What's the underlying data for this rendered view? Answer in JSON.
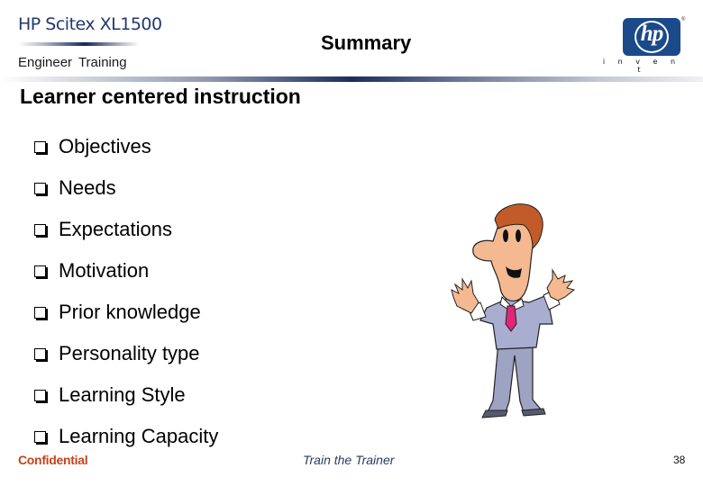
{
  "header": {
    "product_name": "HP Scitex XL1500",
    "subtitle": "Engineer  Training",
    "slide_title": "Summary",
    "logo": {
      "brand": "hp",
      "tagline": "i n v e n t",
      "trademark": "®",
      "color": "#1b4a8a"
    }
  },
  "main": {
    "heading": "Learner centered instruction",
    "bullet_icon": "checkbox-square-icon",
    "bullets": [
      {
        "label": "Objectives"
      },
      {
        "label": "Needs"
      },
      {
        "label": "Expectations"
      },
      {
        "label": "Motivation"
      },
      {
        "label": "Prior knowledge"
      },
      {
        "label": "Personality type"
      },
      {
        "label": "Learning Style"
      },
      {
        "label": "Learning Capacity"
      }
    ],
    "illustration": "cartoon-man-shrugging"
  },
  "footer": {
    "confidential": "Confidential",
    "course": "Train the Trainer",
    "page_number": "38",
    "confidential_color": "#c8421b",
    "course_color": "#2b3a66"
  }
}
